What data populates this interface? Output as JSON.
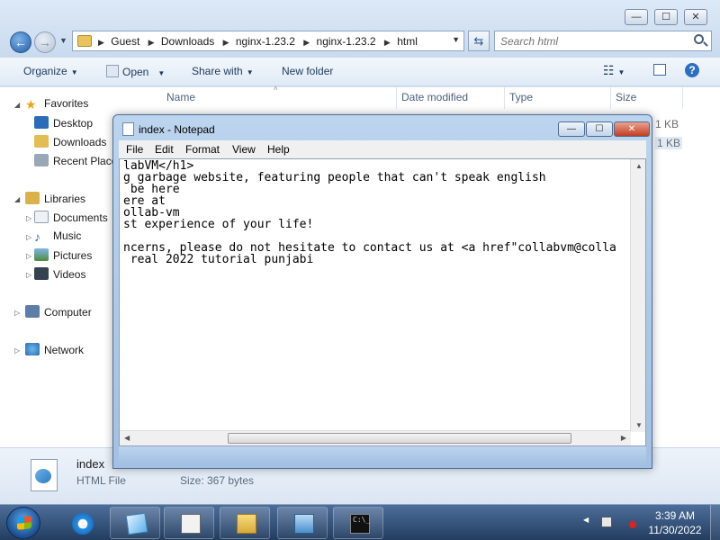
{
  "explorer": {
    "window_controls": [
      "—",
      "☐",
      "✕"
    ],
    "address": {
      "crumbs": [
        "Guest",
        "Downloads",
        "nginx-1.23.2",
        "nginx-1.23.2",
        "html"
      ]
    },
    "search": {
      "placeholder": "Search html"
    },
    "toolbar": {
      "organize": "Organize",
      "open": "Open",
      "share_with": "Share with",
      "new_folder": "New folder"
    },
    "nav": {
      "favorites": "Favorites",
      "desktop": "Desktop",
      "downloads": "Downloads",
      "recent_places": "Recent Places",
      "libraries": "Libraries",
      "documents": "Documents",
      "music": "Music",
      "pictures": "Pictures",
      "videos": "Videos",
      "computer": "Computer",
      "network": "Network"
    },
    "columns": {
      "name": "Name",
      "date_modified": "Date modified",
      "type": "Type",
      "size": "Size"
    },
    "file_sizes": [
      "1 KB",
      "1 KB"
    ],
    "details": {
      "name": "index",
      "type": "HTML File",
      "size": "Size: 367 bytes"
    }
  },
  "notepad": {
    "title": "index - Notepad",
    "menu": [
      "File",
      "Edit",
      "Format",
      "View",
      "Help"
    ],
    "lines": [
      "labVM</h1>",
      "g garbage website, featuring people that can't speak english",
      " be here",
      "ere at",
      "ollab-vm",
      "st experience of your life!",
      "",
      "ncerns, please do not hesitate to contact us at <a href\"collabvm@colla",
      " real 2022 tutorial punjabi"
    ]
  },
  "taskbar": {
    "time": "3:39 AM",
    "date": "11/30/2022"
  },
  "colors": {
    "accent": "#1e395b",
    "taskbar": "#2f4a72",
    "close_red": "#c33d22"
  }
}
